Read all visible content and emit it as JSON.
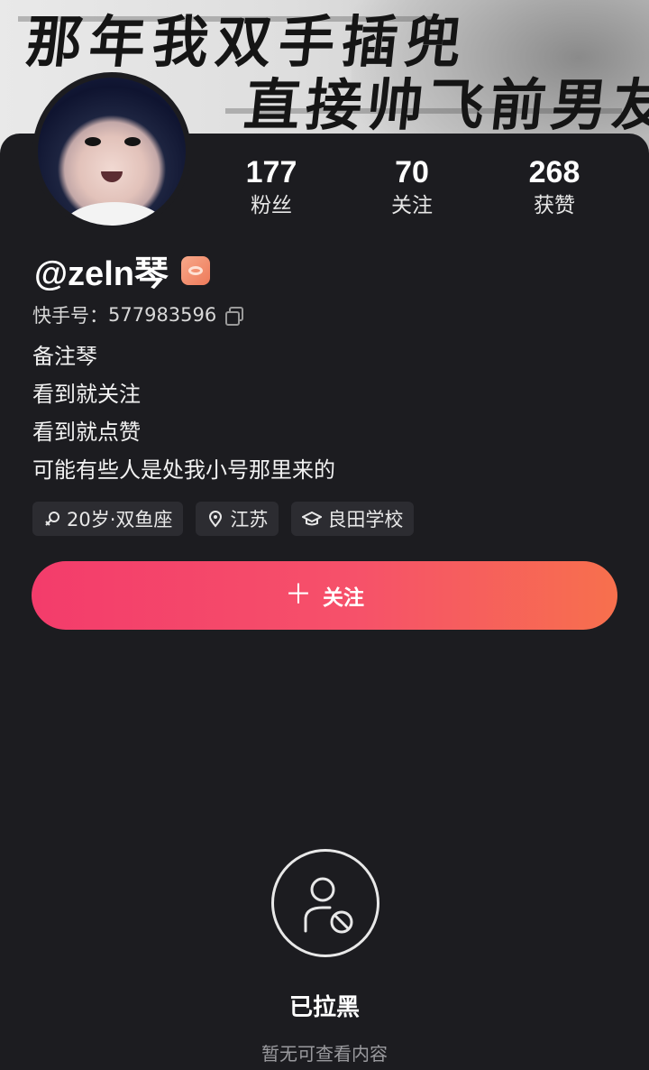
{
  "cover": {
    "line1": "那年我双手插兜",
    "line2": "直接帅飞前男友"
  },
  "stats": [
    {
      "value": "177",
      "label": "粉丝"
    },
    {
      "value": "70",
      "label": "关注"
    },
    {
      "value": "268",
      "label": "获赞"
    }
  ],
  "profile": {
    "name": "@zeln琴",
    "id_label": "快手号：",
    "id_value": "577983596",
    "bio": [
      "备注琴",
      "看到就关注",
      "看到就点赞",
      "可能有些人是处我小号那里来的"
    ]
  },
  "tags": [
    {
      "icon": "gender-female-icon",
      "text": "20岁·双鱼座"
    },
    {
      "icon": "location-pin-icon",
      "text": "江苏"
    },
    {
      "icon": "graduation-cap-icon",
      "text": "良田学校"
    }
  ],
  "follow_button": {
    "icon": "plus-icon",
    "label": "关注"
  },
  "blocked": {
    "icon": "user-blocked-icon",
    "title": "已拉黑",
    "subtitle": "暂无可查看内容"
  },
  "colors": {
    "background": "#1c1c20",
    "button_gradient_start": "#f33c6b",
    "button_gradient_end": "#f7704d",
    "tag_background": "#2c2c31",
    "badge": "#ee7a5a"
  }
}
